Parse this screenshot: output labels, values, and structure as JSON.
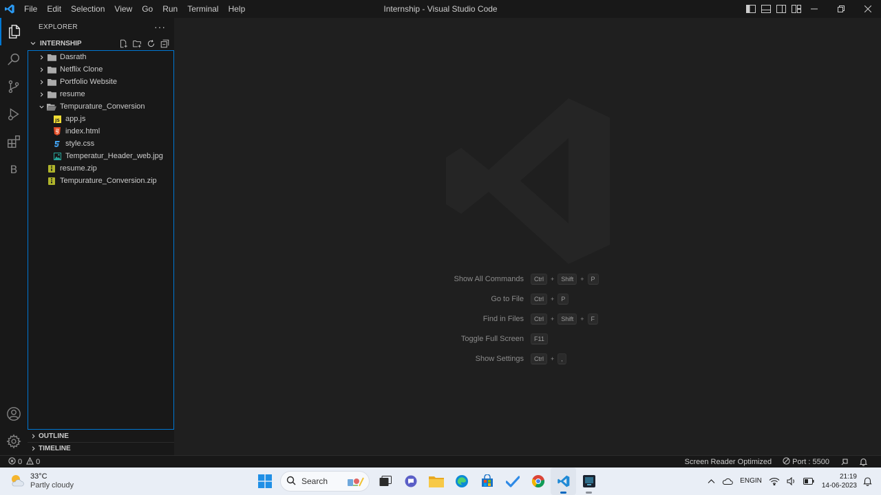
{
  "titlebar": {
    "menu": [
      "File",
      "Edit",
      "Selection",
      "View",
      "Go",
      "Run",
      "Terminal",
      "Help"
    ],
    "window_title": "Internship - Visual Studio Code"
  },
  "activity_bar": {
    "items": [
      "explorer-icon",
      "search-icon",
      "source-control-icon",
      "run-debug-icon",
      "extensions-icon",
      "bookmarks-icon"
    ],
    "letter_item": "B",
    "bottom": [
      "accounts-icon",
      "manage-gear-icon"
    ]
  },
  "explorer": {
    "title": "EXPLORER",
    "more": "···",
    "folder_name": "INTERNSHIP",
    "tree": [
      {
        "label": "Dasrath",
        "type": "folder",
        "expanded": false,
        "depth": 0
      },
      {
        "label": "Netflix Clone",
        "type": "folder",
        "expanded": false,
        "depth": 0
      },
      {
        "label": "Portfolio Website",
        "type": "folder",
        "expanded": false,
        "depth": 0
      },
      {
        "label": "resume",
        "type": "folder",
        "expanded": false,
        "depth": 0
      },
      {
        "label": "Tempurature_Conversion",
        "type": "folder",
        "expanded": true,
        "depth": 0
      },
      {
        "label": "app.js",
        "type": "js",
        "depth": 1
      },
      {
        "label": "index.html",
        "type": "html",
        "depth": 1
      },
      {
        "label": "style.css",
        "type": "css",
        "depth": 1
      },
      {
        "label": "Temperatur_Header_web.jpg",
        "type": "image",
        "depth": 1
      },
      {
        "label": "resume.zip",
        "type": "zip",
        "depth": 0
      },
      {
        "label": "Tempurature_Conversion.zip",
        "type": "zip",
        "depth": 0
      }
    ],
    "outline": "OUTLINE",
    "timeline": "TIMELINE"
  },
  "editor": {
    "shortcuts": [
      {
        "label": "Show All Commands",
        "keys": [
          "Ctrl",
          "Shift",
          "P"
        ]
      },
      {
        "label": "Go to File",
        "keys": [
          "Ctrl",
          "P"
        ]
      },
      {
        "label": "Find in Files",
        "keys": [
          "Ctrl",
          "Shift",
          "F"
        ]
      },
      {
        "label": "Toggle Full Screen",
        "keys": [
          "F11"
        ]
      },
      {
        "label": "Show Settings",
        "keys": [
          "Ctrl",
          ","
        ]
      }
    ]
  },
  "statusbar": {
    "errors": "0",
    "warnings": "0",
    "screen_reader": "Screen Reader Optimized",
    "port": "Port : 5500"
  },
  "taskbar": {
    "temperature": "33°C",
    "weather": "Partly cloudy",
    "search_label": "Search",
    "lang_top": "ENG",
    "lang_bottom": "IN",
    "time": "21:19",
    "date": "14-06-2023"
  },
  "colors": {
    "accent": "#0078d4",
    "folder": "#c5c5c5",
    "js": "#f1dd35",
    "html": "#e44d26",
    "css": "#42a5f5",
    "image": "#26a69a",
    "zip": "#afb42b"
  }
}
